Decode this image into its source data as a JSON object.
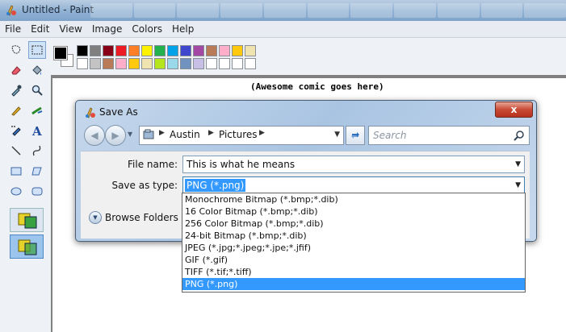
{
  "window": {
    "title": "Untitled - Paint"
  },
  "menu": [
    "File",
    "Edit",
    "View",
    "Image",
    "Colors",
    "Help"
  ],
  "palette": {
    "row1": [
      "#000000",
      "#7f7f7f",
      "#880015",
      "#ed1c24",
      "#ff7f27",
      "#fff200",
      "#22b14c",
      "#00a2e8",
      "#3f48cc",
      "#a349a4",
      "#b97a57",
      "#ffaec9",
      "#ffc90e",
      "#efe4b0"
    ],
    "row2": [
      "#ffffff",
      "#c3c3c3",
      "#b97a57",
      "#ffaec9",
      "#ffc90e",
      "#efe4b0",
      "#b5e61d",
      "#99d9ea",
      "#7092be",
      "#c8bfe7",
      "#ffffff",
      "#ffffff",
      "#ffffff",
      "#ffffff"
    ]
  },
  "canvas": {
    "comic_text": "(Awesome comic goes here)"
  },
  "dialog": {
    "title": "Save As",
    "close_label": "x",
    "address": [
      "Austin",
      "Pictures"
    ],
    "search_placeholder": "Search",
    "file_name_label": "File name:",
    "file_name_value": "This is what he means",
    "save_type_label": "Save as type:",
    "save_type_value": "PNG (*.png)",
    "browse_folders_label": "Browse Folders"
  },
  "file_types": [
    {
      "label": "Monochrome Bitmap (*.bmp;*.dib)",
      "selected": false
    },
    {
      "label": "16 Color Bitmap (*.bmp;*.dib)",
      "selected": false
    },
    {
      "label": "256 Color Bitmap (*.bmp;*.dib)",
      "selected": false
    },
    {
      "label": "24-bit Bitmap (*.bmp;*.dib)",
      "selected": false
    },
    {
      "label": "JPEG (*.jpg;*.jpeg;*.jpe;*.jfif)",
      "selected": false
    },
    {
      "label": "GIF (*.gif)",
      "selected": false
    },
    {
      "label": "TIFF (*.tif;*.tiff)",
      "selected": false
    },
    {
      "label": "PNG (*.png)",
      "selected": true
    }
  ],
  "icons": {
    "app": "paint-icon",
    "tools": [
      "free-select-icon",
      "rect-select-icon",
      "eraser-icon",
      "fill-icon",
      "color-picker-icon",
      "magnifier-icon",
      "pencil-icon",
      "brush-icon",
      "airbrush-icon",
      "text-icon",
      "line-icon",
      "curve-icon",
      "rectangle-icon",
      "polygon-icon",
      "ellipse-icon",
      "rounded-rect-icon"
    ]
  }
}
